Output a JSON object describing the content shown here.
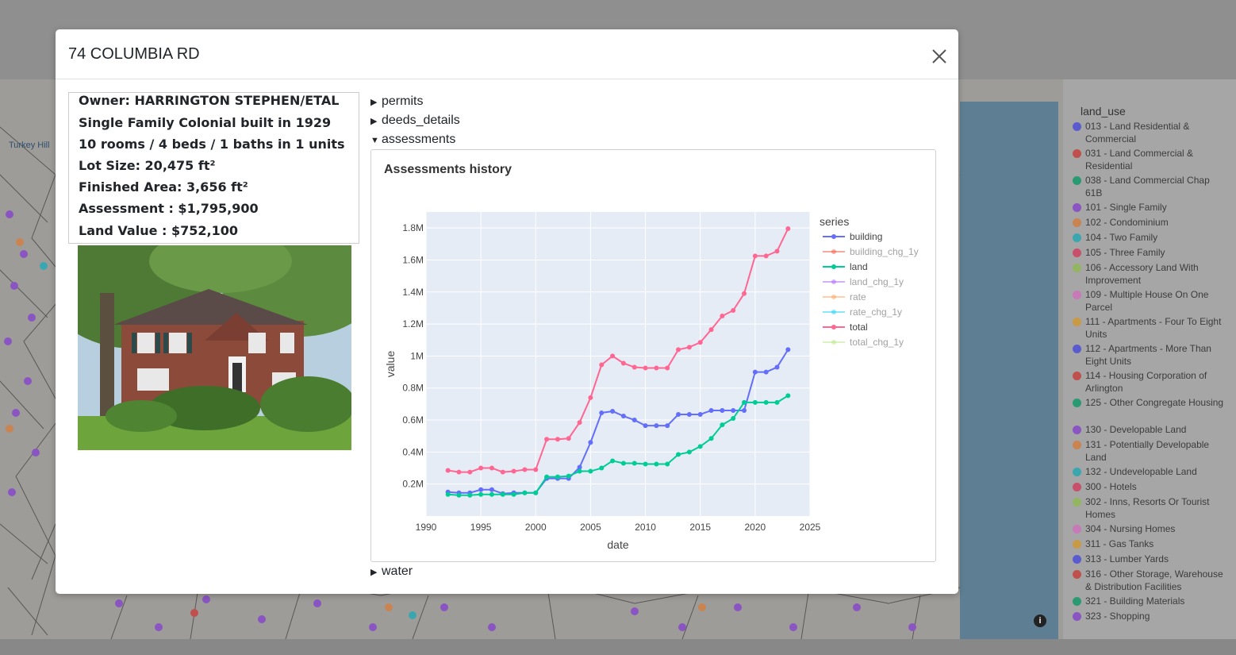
{
  "modal": {
    "title": "74 COLUMBIA RD",
    "close_icon": "close-icon"
  },
  "info": {
    "owner": "Owner: HARRINGTON STEPHEN/ETAL",
    "style": "Single Family Colonial built in 1929",
    "rooms": "10 rooms / 4 beds / 1 baths in 1 units",
    "lot_size": "Lot Size: 20,475 ft²",
    "finished_area": "Finished Area: 3,656 ft²",
    "assessment": "Assessment : $1,795,900",
    "land_value": "Land Value : $752,100"
  },
  "sections": {
    "permits": "permits",
    "deeds": "deeds_details",
    "assessments": "assessments",
    "water": "water"
  },
  "map": {
    "place_label": "Turkey Hill",
    "info_icon": "info-icon"
  },
  "legend": {
    "title": "land_use",
    "items": [
      {
        "label": "013 - Land Residential & Commercial",
        "color": "#5b5bd0"
      },
      {
        "label": "031 - Land Commercial & Residential",
        "color": "#c0504d"
      },
      {
        "label": "038 - Land Commercial Chap 61B",
        "color": "#2a9a72"
      },
      {
        "label": "101 - Single Family",
        "color": "#8a55c2"
      },
      {
        "label": "102 - Condominium",
        "color": "#c98451"
      },
      {
        "label": "104 - Two Family",
        "color": "#3aa7b0"
      },
      {
        "label": "105 - Three Family",
        "color": "#c9506a"
      },
      {
        "label": "106 - Accessory Land With Improvement",
        "color": "#93b561"
      },
      {
        "label": "109 - Multiple House On One Parcel",
        "color": "#c879b8"
      },
      {
        "label": "111 - Apartments - Four To Eight Units",
        "color": "#c99a45"
      },
      {
        "label": "112 - Apartments - More Than Eight Units",
        "color": "#5b5bd0"
      },
      {
        "label": "114 - Housing Corporation of Arlington",
        "color": "#c0504d"
      },
      {
        "label": "125 - Other Congregate Housing",
        "color": "#2a9a72"
      },
      {
        "label": "130 - Developable Land",
        "color": "#8a55c2"
      },
      {
        "label": "131 - Potentially Developable Land",
        "color": "#c98451"
      },
      {
        "label": "132 - Undevelopable Land",
        "color": "#3aa7b0"
      },
      {
        "label": "300 - Hotels",
        "color": "#c9506a"
      },
      {
        "label": "302 - Inns, Resorts Or Tourist Homes",
        "color": "#93b561"
      },
      {
        "label": "304 - Nursing Homes",
        "color": "#c879b8"
      },
      {
        "label": "311 - Gas Tanks",
        "color": "#c99a45"
      },
      {
        "label": "313 - Lumber Yards",
        "color": "#5b5bd0"
      },
      {
        "label": "316 - Other Storage, Warehouse & Distribution Facilities",
        "color": "#c0504d"
      },
      {
        "label": "321 - Building Materials",
        "color": "#2a9a72"
      },
      {
        "label": "323 - Shopping",
        "color": "#8a55c2"
      }
    ]
  },
  "chart_data": {
    "type": "line",
    "title": "Assessments history",
    "xlabel": "date",
    "ylabel": "value",
    "xlim": [
      1990,
      2025
    ],
    "ylim": [
      0,
      1900000
    ],
    "x_ticks": [
      "1990",
      "1995",
      "2000",
      "2005",
      "2010",
      "2015",
      "2020",
      "2025"
    ],
    "y_ticks": [
      "0.2M",
      "0.4M",
      "0.6M",
      "0.8M",
      "1M",
      "1.2M",
      "1.4M",
      "1.6M",
      "1.8M"
    ],
    "legend_title": "series",
    "legend_position": "right",
    "grid": true,
    "x": [
      1992,
      1993,
      1994,
      1995,
      1996,
      1997,
      1998,
      1999,
      2000,
      2001,
      2002,
      2003,
      2004,
      2005,
      2006,
      2007,
      2008,
      2009,
      2010,
      2011,
      2012,
      2013,
      2014,
      2015,
      2016,
      2017,
      2018,
      2019,
      2020,
      2021,
      2022,
      2023
    ],
    "series": [
      {
        "name": "building",
        "color": "#636efa",
        "visible": true,
        "values": [
          150000,
          145000,
          145000,
          165000,
          165000,
          140000,
          145000,
          145000,
          145000,
          235000,
          235000,
          235000,
          305000,
          460000,
          645000,
          655000,
          625000,
          600000,
          565000,
          565000,
          565000,
          635000,
          635000,
          635000,
          660000,
          660000,
          660000,
          660000,
          900000,
          900000,
          930000,
          1040000
        ]
      },
      {
        "name": "building_chg_1y",
        "color": "#ef553b",
        "visible": false,
        "values": []
      },
      {
        "name": "land",
        "color": "#00cc96",
        "visible": true,
        "values": [
          135000,
          130000,
          130000,
          135000,
          135000,
          135000,
          135000,
          145000,
          145000,
          245000,
          245000,
          250000,
          280000,
          280000,
          300000,
          345000,
          330000,
          330000,
          325000,
          325000,
          325000,
          385000,
          400000,
          435000,
          485000,
          570000,
          610000,
          710000,
          710000,
          710000,
          710000,
          752100
        ]
      },
      {
        "name": "land_chg_1y",
        "color": "#ab63fa",
        "visible": false,
        "values": []
      },
      {
        "name": "rate",
        "color": "#ffa15a",
        "visible": false,
        "values": []
      },
      {
        "name": "rate_chg_1y",
        "color": "#19d3f3",
        "visible": false,
        "values": []
      },
      {
        "name": "total",
        "color": "#ff6692",
        "visible": true,
        "values": [
          285000,
          275000,
          275000,
          300000,
          300000,
          275000,
          280000,
          290000,
          290000,
          480000,
          480000,
          485000,
          585000,
          740000,
          945000,
          1000000,
          955000,
          930000,
          925000,
          925000,
          925000,
          1040000,
          1055000,
          1085000,
          1165000,
          1250000,
          1285000,
          1390000,
          1625000,
          1625000,
          1655000,
          1795900
        ]
      },
      {
        "name": "total_chg_1y",
        "color": "#b6e880",
        "visible": false,
        "values": []
      }
    ]
  }
}
